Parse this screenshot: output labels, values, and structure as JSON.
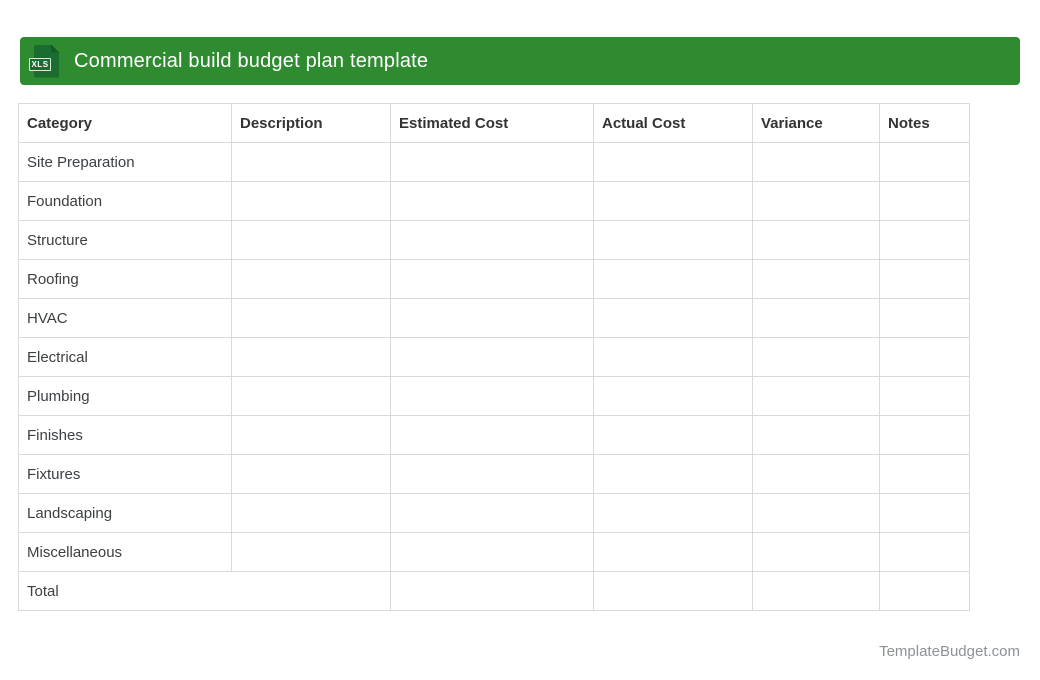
{
  "header": {
    "title": "Commercial build budget plan template",
    "icon": {
      "label": "XLS"
    }
  },
  "table": {
    "columns": [
      "Category",
      "Description",
      "Estimated Cost",
      "Actual Cost",
      "Variance",
      "Notes"
    ],
    "rows": [
      "Site Preparation",
      "Foundation",
      "Structure",
      "Roofing",
      "HVAC",
      "Electrical",
      "Plumbing",
      "Finishes",
      "Fixtures",
      "Landscaping",
      "Miscellaneous"
    ],
    "total_label": "Total"
  },
  "footer": {
    "credit": "TemplateBudget.com"
  },
  "colors": {
    "header_bar": "#2f8b30",
    "icon_doc": "#1b6c30",
    "icon_fold": "#155a27",
    "badge_border": "#d7ecd7",
    "title_text": "#ffffff",
    "table_border": "#d9d9d9",
    "header_text": "#333333",
    "cell_text": "#3c4043",
    "footer_text": "#8d9297"
  }
}
